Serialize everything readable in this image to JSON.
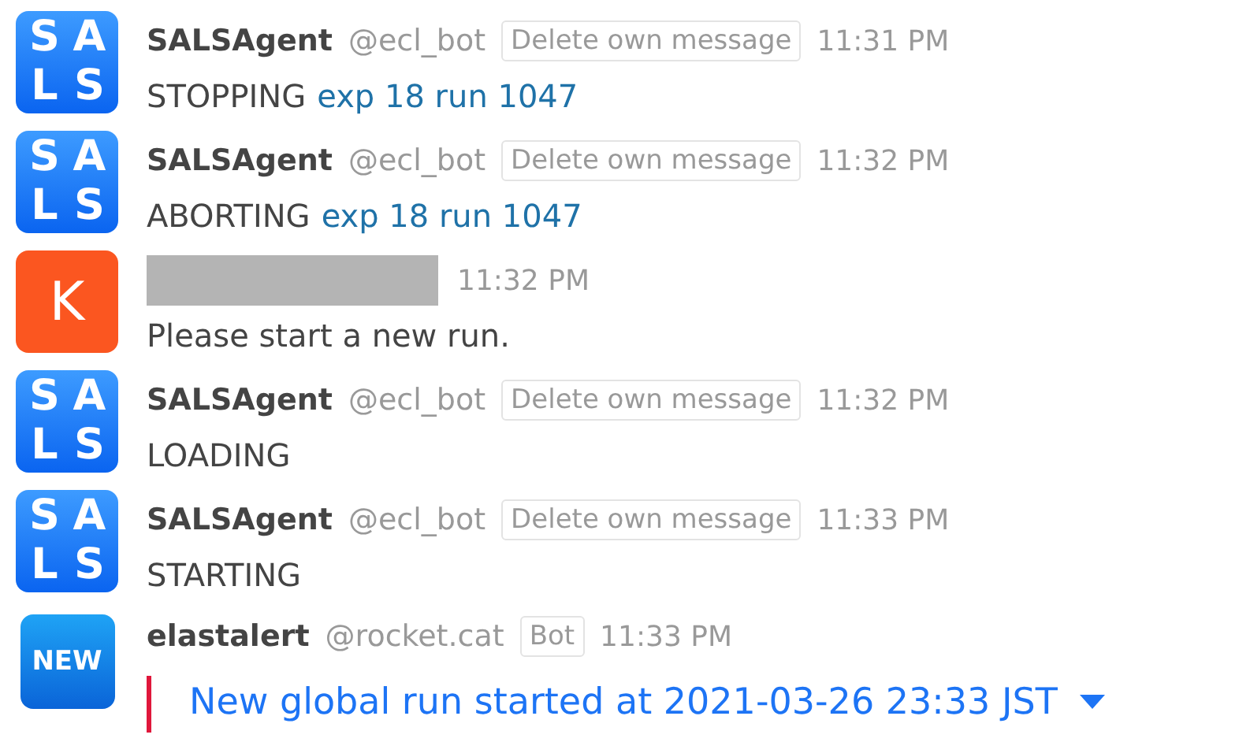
{
  "messages": [
    {
      "avatar": {
        "kind": "letters",
        "letters": [
          "S",
          "A",
          "L",
          "S"
        ]
      },
      "name": "SALSAgent",
      "handle": "@ecl_bot",
      "tag": "Delete own message",
      "time": "11:31 PM",
      "body": [
        {
          "text": "STOPPING",
          "link": false
        },
        {
          "text": "exp 18 run 1047",
          "link": true
        }
      ]
    },
    {
      "avatar": {
        "kind": "letters",
        "letters": [
          "S",
          "A",
          "L",
          "S"
        ]
      },
      "name": "SALSAgent",
      "handle": "@ecl_bot",
      "tag": "Delete own message",
      "time": "11:32 PM",
      "body": [
        {
          "text": "ABORTING",
          "link": false
        },
        {
          "text": "exp 18 run 1047",
          "link": true
        }
      ]
    },
    {
      "avatar": {
        "kind": "initial",
        "letters": [
          "K"
        ]
      },
      "redacted": true,
      "time": "11:32 PM",
      "body": [
        {
          "text": "Please start a new run.",
          "link": false
        }
      ]
    },
    {
      "avatar": {
        "kind": "letters",
        "letters": [
          "S",
          "A",
          "L",
          "S"
        ]
      },
      "name": "SALSAgent",
      "handle": "@ecl_bot",
      "tag": "Delete own message",
      "time": "11:32 PM",
      "body": [
        {
          "text": "LOADING",
          "link": false
        }
      ]
    },
    {
      "avatar": {
        "kind": "letters",
        "letters": [
          "S",
          "A",
          "L",
          "S"
        ]
      },
      "name": "SALSAgent",
      "handle": "@ecl_bot",
      "tag": "Delete own message",
      "time": "11:33 PM",
      "body": [
        {
          "text": "STARTING",
          "link": false
        }
      ]
    },
    {
      "avatar": {
        "kind": "badge",
        "letters": [
          "NEW"
        ]
      },
      "name": "elastalert",
      "handle": "@rocket.cat",
      "tag": "Bot",
      "time": "11:33 PM",
      "attachment": {
        "title": "New global run started at 2021-03-26 23:33 JST",
        "expanded": false
      }
    }
  ]
}
